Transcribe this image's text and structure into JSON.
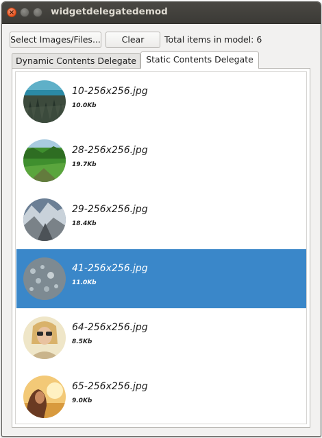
{
  "window": {
    "title": "widgetdelegatedemod"
  },
  "toolbar": {
    "select_label": "Select Images/Files...",
    "clear_label": "Clear",
    "count_text": "Total items in model: 6"
  },
  "tabs": [
    {
      "label": "Dynamic Contents Delegate",
      "active": false
    },
    {
      "label": "Static Contents Delegate",
      "active": true
    }
  ],
  "items": [
    {
      "name": "10-256x256.jpg",
      "size": "10.0Kb",
      "selected": false,
      "thumb": "forest-lake-photo"
    },
    {
      "name": "28-256x256.jpg",
      "size": "19.7Kb",
      "selected": false,
      "thumb": "green-valley-photo"
    },
    {
      "name": "29-256x256.jpg",
      "size": "18.4Kb",
      "selected": false,
      "thumb": "snowy-mountains-photo"
    },
    {
      "name": "41-256x256.jpg",
      "size": "11.0Kb",
      "selected": true,
      "thumb": "water-droplets-photo"
    },
    {
      "name": "64-256x256.jpg",
      "size": "8.5Kb",
      "selected": false,
      "thumb": "woman-sunglasses-photo"
    },
    {
      "name": "65-256x256.jpg",
      "size": "9.0Kb",
      "selected": false,
      "thumb": "sunset-portrait-photo"
    }
  ],
  "colors": {
    "selection": "#3a87c9",
    "titlebar": "#3c3b37",
    "close_button": "#e95420"
  }
}
